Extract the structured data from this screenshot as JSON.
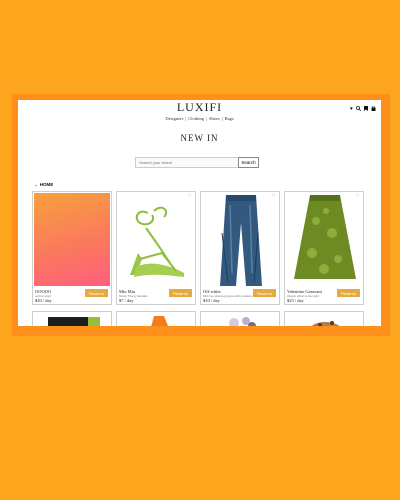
{
  "header": {
    "brand": "LUXIFI",
    "nav": [
      "Designers",
      "Clothing",
      "Shoes",
      "Bags"
    ],
    "nav_separator": "|",
    "icons": [
      "heart-icon",
      "search-icon",
      "bookmark-icon",
      "bag-icon"
    ]
  },
  "page": {
    "title": "NEW IN",
    "back_link": "← HOME"
  },
  "search": {
    "placeholder": "Search your brand",
    "button_label": "Search"
  },
  "products": [
    {
      "name": "OOOOO",
      "description": "ombre scarf",
      "price": "$20 / day",
      "reserve_label": "Reserve",
      "image": "gradient-swatch"
    },
    {
      "name": "Miu Miu",
      "description": "Mode Thong Sandals",
      "price": "$7 / day",
      "reserve_label": "Reserve",
      "image": "green-strappy-sandal"
    },
    {
      "name": "Off-white",
      "description": "Mid rise wide-leg pants with ornately pan",
      "price": "$10 / day",
      "reserve_label": "Reserve",
      "image": "blue-leather-pants"
    },
    {
      "name": "Valentino Garavani",
      "description": "classic effect H-line skirt",
      "price": "$25 / day",
      "reserve_label": "Reserve",
      "image": "green-lace-skirt"
    }
  ],
  "colors": {
    "background": "#fda51c",
    "frame": "#fd8f1a",
    "reserve_button": "#e6ab3e"
  }
}
